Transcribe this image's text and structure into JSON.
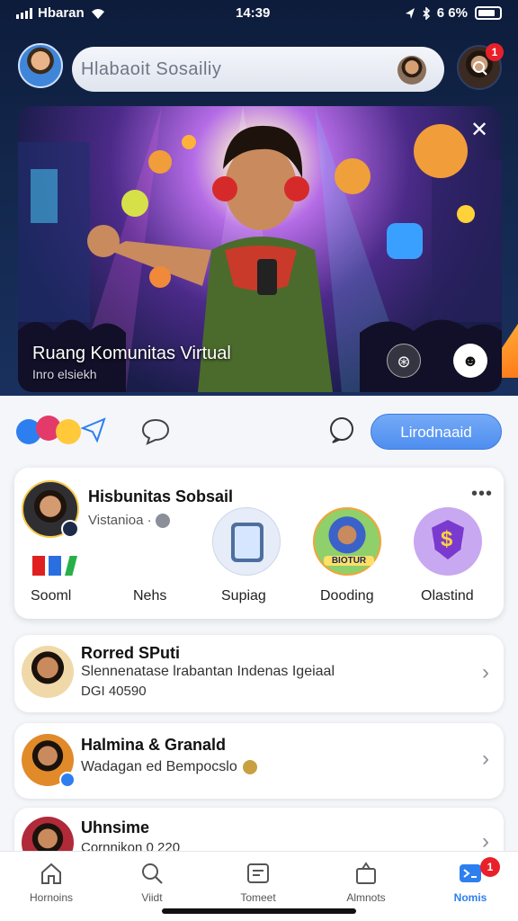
{
  "status_bar": {
    "carrier": "Hbaran",
    "time": "14:39",
    "battery": "6 6%"
  },
  "search": {
    "placeholder": "Hlabaoit Sosailiy"
  },
  "profile": {
    "notification_count": "1"
  },
  "banner": {
    "title": "Ruang Komunitas Virtual",
    "subtitle": "Inro elsiekh"
  },
  "actions": {
    "primary_button": "Lirodnaaid"
  },
  "community_card": {
    "title": "Hisbunitas Sobsail",
    "subtitle": "Vistanioa ·",
    "items": [
      {
        "label": "Sooml"
      },
      {
        "label": "Nehs"
      },
      {
        "label": "Supiag"
      },
      {
        "label": "Dooding"
      },
      {
        "label": "Olastind"
      }
    ],
    "circle_badge": "BIOTUR"
  },
  "list": [
    {
      "name": "Rorred SPuti",
      "description": "Slennenatase lrabantan Indenas Igeiaal",
      "meta": "DGI 40590"
    },
    {
      "name": "Halmina & Granald",
      "description": "Wadagan ed Bempocslo",
      "meta": ""
    },
    {
      "name": "Uhnsime",
      "description": "Cornnikon 0 220",
      "meta": ""
    }
  ],
  "bottom_nav": {
    "items": [
      {
        "label": "Hornoins",
        "icon": "home-icon"
      },
      {
        "label": "Viidt",
        "icon": "search-icon"
      },
      {
        "label": "Tomeet",
        "icon": "message-icon"
      },
      {
        "label": "Almnots",
        "icon": "bag-icon"
      },
      {
        "label": "Nomis",
        "icon": "apps-icon"
      }
    ],
    "badge": "1",
    "active": "Nomis"
  },
  "colors": {
    "accent": "#2d7ff0",
    "header": "#14284e",
    "badge": "#e8202a"
  }
}
